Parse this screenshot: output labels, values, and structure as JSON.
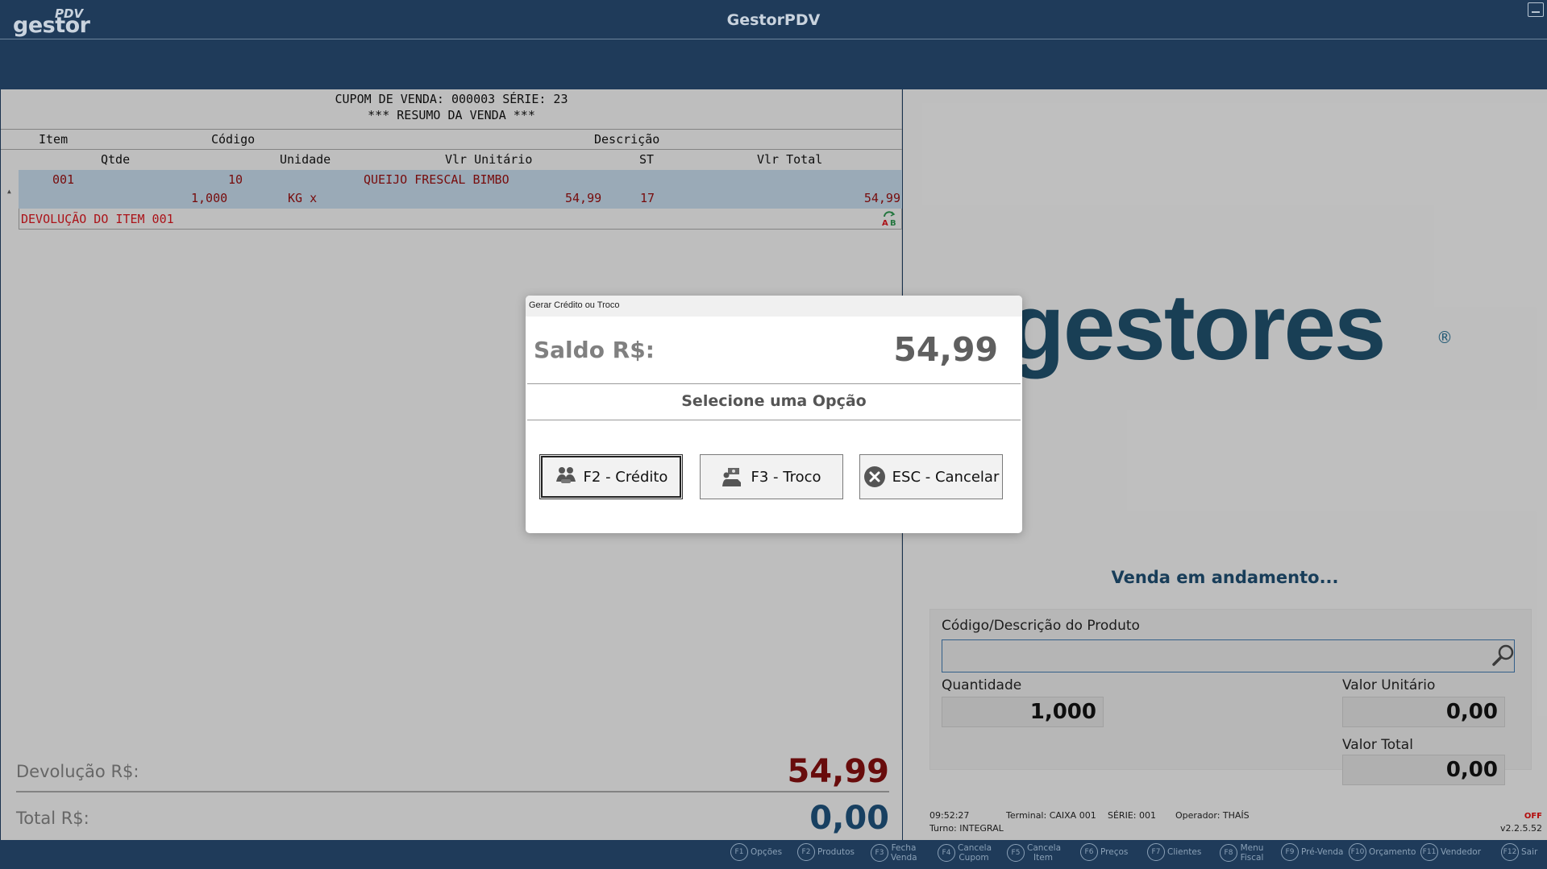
{
  "header": {
    "logo_pdv": "PDV",
    "logo_name": "gestor",
    "title": "GestorPDV"
  },
  "receipt": {
    "heading1": "CUPOM DE VENDA: 000003  SÉRIE: 23",
    "heading2": "*** RESUMO DA VENDA ***",
    "columns1": {
      "item": "Item",
      "codigo": "Código",
      "descricao": "Descrição"
    },
    "columns2": {
      "qtde": "Qtde",
      "unidade": "Unidade",
      "vlr_unitario": "Vlr Unitário",
      "st": "ST",
      "vlr_total": "Vlr Total"
    },
    "row": {
      "item": "001",
      "codigo": "10",
      "descricao": "QUEIJO FRESCAL BIMBO",
      "qtde": "1,000",
      "unidade": "KG x",
      "vlr_unitario": "54,99",
      "st": "17",
      "vlr_total": "54,99"
    },
    "devolucao_text": "DEVOLUÇÃO DO ITEM 001"
  },
  "totals": {
    "devolucao_label": "Devolução R$:",
    "devolucao_value": "54,99",
    "total_label": "Total R$:",
    "total_value": "0,00"
  },
  "right": {
    "brand": "gestores",
    "brand_reg": "®",
    "status": "Venda em andamento...",
    "product_label": "Código/Descrição do Produto",
    "product_value": "",
    "qty_label": "Quantidade",
    "qty_value": "1,000",
    "unit_label": "Valor Unitário",
    "unit_value": "0,00",
    "total_label": "Valor Total",
    "total_value": "0,00"
  },
  "footer": {
    "time": "09:52:27",
    "terminal": "Terminal: CAIXA 001",
    "serie": "SÉRIE: 001",
    "operador": "Operador: THAÍS",
    "turno": "Turno: INTEGRAL",
    "off": "OFF",
    "version": "v2.2.5.52"
  },
  "modal": {
    "caption": "Gerar Crédito ou Troco",
    "saldo_label": "Saldo R$:",
    "saldo_value": "54,99",
    "option_title": "Selecione uma Opção",
    "btn_credito": "F2 - Crédito",
    "btn_troco": "F3 - Troco",
    "btn_cancelar": "ESC - Cancelar"
  },
  "fnkeys": [
    {
      "key": "F1",
      "label": "Opções"
    },
    {
      "key": "F2",
      "label": "Produtos"
    },
    {
      "key": "F3",
      "label": "Fecha Venda"
    },
    {
      "key": "F4",
      "label": "Cancela Cupom"
    },
    {
      "key": "F5",
      "label": "Cancela Item"
    },
    {
      "key": "F6",
      "label": "Preços"
    },
    {
      "key": "F7",
      "label": "Clientes"
    },
    {
      "key": "F8",
      "label": "Menu Fiscal"
    },
    {
      "key": "F9",
      "label": "Pré-Venda"
    },
    {
      "key": "F10",
      "label": "Orçamento"
    },
    {
      "key": "F11",
      "label": "Vendedor"
    },
    {
      "key": "F12",
      "label": "Sair"
    }
  ],
  "colors": {
    "header_bg": "#1f3b5a",
    "panel_bg": "#dedede",
    "brand": "#1e4a63",
    "devolucao_red": "#7a0f0f",
    "total_blue": "#1d4b72",
    "row_highlight": "#b4c6d6"
  }
}
